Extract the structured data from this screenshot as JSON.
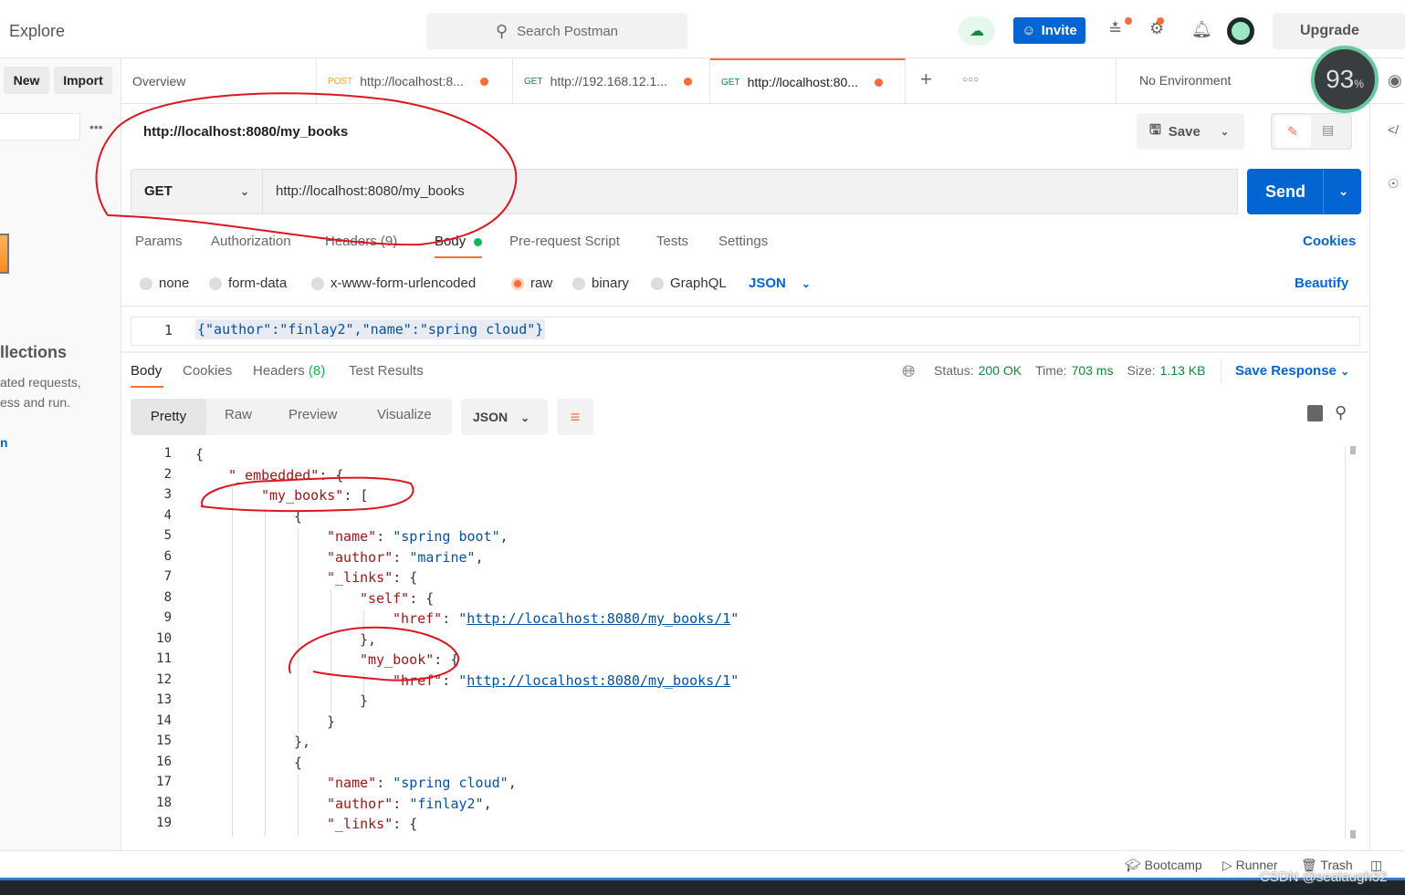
{
  "header": {
    "title": "Explore",
    "search_placeholder": "Search Postman",
    "invite": "Invite",
    "upgrade": "Upgrade"
  },
  "sidebar": {
    "new": "New",
    "import": "Import",
    "heading": "llections",
    "desc1": "ated requests,",
    "desc2": "ess and run.",
    "link": "n"
  },
  "tabs": [
    {
      "label": "Overview"
    },
    {
      "method": "POST",
      "label": "http://localhost:8...",
      "method_color": "#f5a623"
    },
    {
      "method": "GET",
      "label": "http://192.168.12.1...",
      "method_color": "#0f8a3c"
    },
    {
      "method": "GET",
      "label": "http://localhost:80...",
      "method_color": "#0f8a3c",
      "active": true
    }
  ],
  "environment": "No Environment",
  "perf_badge": {
    "value": "93",
    "unit": "%"
  },
  "request": {
    "title": "http://localhost:8080/my_books",
    "method": "GET",
    "url": "http://localhost:8080/my_books",
    "save": "Save",
    "send": "Send",
    "cookies": "Cookies",
    "beautify": "Beautify",
    "tabs": [
      "Params",
      "Authorization",
      "Headers (9)",
      "Body",
      "Pre-request Script",
      "Tests",
      "Settings"
    ],
    "body_types": [
      "none",
      "form-data",
      "x-www-form-urlencoded",
      "raw",
      "binary",
      "GraphQL"
    ],
    "body_lang": "JSON",
    "body_line_no": "1",
    "body_text": "{\"author\":\"finlay2\",\"name\":\"spring cloud\"}"
  },
  "response": {
    "tabs": [
      "Body",
      "Cookies",
      "Headers",
      "Test Results"
    ],
    "headers_count": "(8)",
    "status_label": "Status:",
    "status": "200 OK",
    "time_label": "Time:",
    "time": "703 ms",
    "size_label": "Size:",
    "size": "1.13 KB",
    "save_response": "Save Response",
    "views": [
      "Pretty",
      "Raw",
      "Preview",
      "Visualize"
    ],
    "lang": "JSON",
    "lines": [
      {
        "i": 0,
        "t": [
          [
            "p",
            "{"
          ]
        ]
      },
      {
        "i": 1,
        "t": [
          [
            "k",
            "\"_embedded\""
          ],
          [
            "p",
            ": {"
          ]
        ]
      },
      {
        "i": 2,
        "t": [
          [
            "k",
            "\"my_books\""
          ],
          [
            "p",
            ": ["
          ]
        ]
      },
      {
        "i": 3,
        "t": [
          [
            "p",
            "{"
          ]
        ]
      },
      {
        "i": 4,
        "t": [
          [
            "k",
            "\"name\""
          ],
          [
            "p",
            ": "
          ],
          [
            "s",
            "\"spring boot\""
          ],
          [
            "p",
            ","
          ]
        ]
      },
      {
        "i": 4,
        "t": [
          [
            "k",
            "\"author\""
          ],
          [
            "p",
            ": "
          ],
          [
            "s",
            "\"marine\""
          ],
          [
            "p",
            ","
          ]
        ]
      },
      {
        "i": 4,
        "t": [
          [
            "k",
            "\"_links\""
          ],
          [
            "p",
            ": {"
          ]
        ]
      },
      {
        "i": 5,
        "t": [
          [
            "k",
            "\"self\""
          ],
          [
            "p",
            ": {"
          ]
        ]
      },
      {
        "i": 6,
        "t": [
          [
            "k",
            "\"href\""
          ],
          [
            "p",
            ": "
          ],
          [
            "s",
            "\""
          ],
          [
            "a",
            "http://localhost:8080/my_books/1"
          ],
          [
            "s",
            "\""
          ]
        ]
      },
      {
        "i": 5,
        "t": [
          [
            "p",
            "},"
          ]
        ]
      },
      {
        "i": 5,
        "t": [
          [
            "k",
            "\"my_book\""
          ],
          [
            "p",
            ": {"
          ]
        ]
      },
      {
        "i": 6,
        "t": [
          [
            "k",
            "\"href\""
          ],
          [
            "p",
            ": "
          ],
          [
            "s",
            "\""
          ],
          [
            "a",
            "http://localhost:8080/my_books/1"
          ],
          [
            "s",
            "\""
          ]
        ]
      },
      {
        "i": 5,
        "t": [
          [
            "p",
            "}"
          ]
        ]
      },
      {
        "i": 4,
        "t": [
          [
            "p",
            "}"
          ]
        ]
      },
      {
        "i": 3,
        "t": [
          [
            "p",
            "},"
          ]
        ]
      },
      {
        "i": 3,
        "t": [
          [
            "p",
            "{"
          ]
        ]
      },
      {
        "i": 4,
        "t": [
          [
            "k",
            "\"name\""
          ],
          [
            "p",
            ": "
          ],
          [
            "s",
            "\"spring cloud\""
          ],
          [
            "p",
            ","
          ]
        ]
      },
      {
        "i": 4,
        "t": [
          [
            "k",
            "\"author\""
          ],
          [
            "p",
            ": "
          ],
          [
            "s",
            "\"finlay2\""
          ],
          [
            "p",
            ","
          ]
        ]
      },
      {
        "i": 4,
        "t": [
          [
            "k",
            "\"_links\""
          ],
          [
            "p",
            ": {"
          ]
        ]
      }
    ]
  },
  "footer": {
    "bootcamp": "Bootcamp",
    "runner": "Runner",
    "trash": "Trash",
    "watermark": "CSDN @sealaugh32"
  },
  "colors": {
    "accent": "#ff6c37",
    "primary": "#0265d2",
    "success": "#0f8a3c",
    "annotation": "#e0141e"
  }
}
